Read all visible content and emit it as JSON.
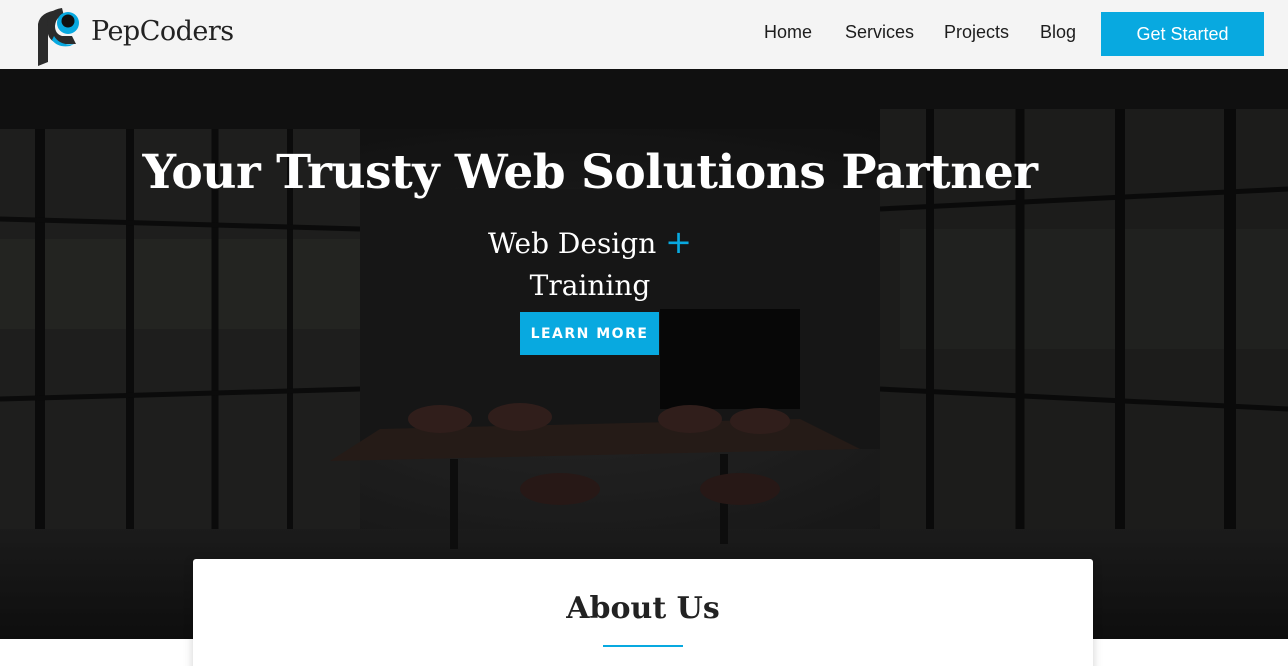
{
  "brand": {
    "name": "PepCoders",
    "logo_icon": "pepcoders-logo-icon",
    "accent_color": "#08a9e0"
  },
  "nav": {
    "items": [
      {
        "label": "Home"
      },
      {
        "label": "Services"
      },
      {
        "label": "Projects"
      },
      {
        "label": "Blog"
      }
    ],
    "cta_label": "Get Started"
  },
  "hero": {
    "title": "Your Trusty Web Solutions Partner",
    "subtitle_line1": "Web Design",
    "subtitle_plus": "+",
    "subtitle_line2": "Training",
    "button_label": "LEARN MORE",
    "background": "dark office interior photo"
  },
  "about": {
    "title": "About Us"
  }
}
